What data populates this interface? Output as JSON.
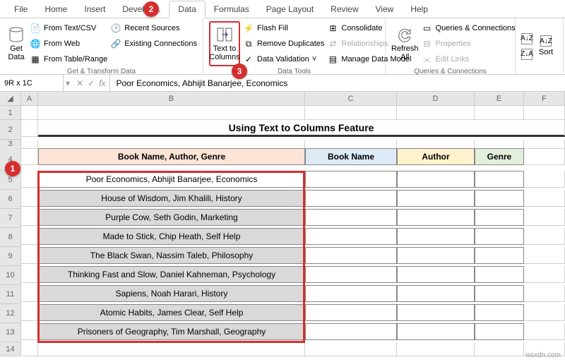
{
  "tabs": [
    "File",
    "Home",
    "Insert",
    "Develop...",
    "Data",
    "Formulas",
    "Page Layout",
    "Review",
    "View",
    "Help"
  ],
  "active_tab": "Data",
  "ribbon": {
    "get_transform": {
      "label": "Get & Transform Data",
      "get_data": "Get\nData",
      "items": [
        "From Text/CSV",
        "From Web",
        "From Table/Range",
        "Recent Sources",
        "Existing Connections"
      ]
    },
    "text_to_columns": "Text to\nColumns",
    "data_tools": {
      "label": "Data Tools",
      "items": [
        "Flash Fill",
        "Remove Duplicates",
        "Data Validation",
        "Consolidate",
        "Relationships",
        "Manage Data Model"
      ]
    },
    "queries": {
      "label": "Queries & Connections",
      "refresh": "Refresh\nAll",
      "items": [
        "Queries & Connections",
        "Properties",
        "Edit Links"
      ]
    },
    "sort": "Sort"
  },
  "name_box": "9R x 1C",
  "formula": "Poor Economics, Abhijit Banarjee, Economics",
  "columns": [
    "",
    "A",
    "B",
    "C",
    "D",
    "E",
    "F"
  ],
  "title": "Using Text to Columns Feature",
  "headers": {
    "b": "Book Name, Author, Genre",
    "c": "Book Name",
    "d": "Author",
    "e": "Genre"
  },
  "rows": [
    "Poor Economics, Abhijit Banarjee, Economics",
    "House of Wisdom, Jim Khalili, History",
    "Purple Cow, Seth Godin, Marketing",
    "Made to Stick, Chip Heath, Self Help",
    "The Black Swan, Nassim Taleb, Philosophy",
    "Thinking Fast and Slow, Daniel Kahneman, Psychology",
    "Sapiens, Noah Harari, History",
    "Atomic Habits, James Clear, Self Help",
    "Prisoners of Geography, Tim Marshall, Geography"
  ],
  "watermark": "wsxdn.com"
}
